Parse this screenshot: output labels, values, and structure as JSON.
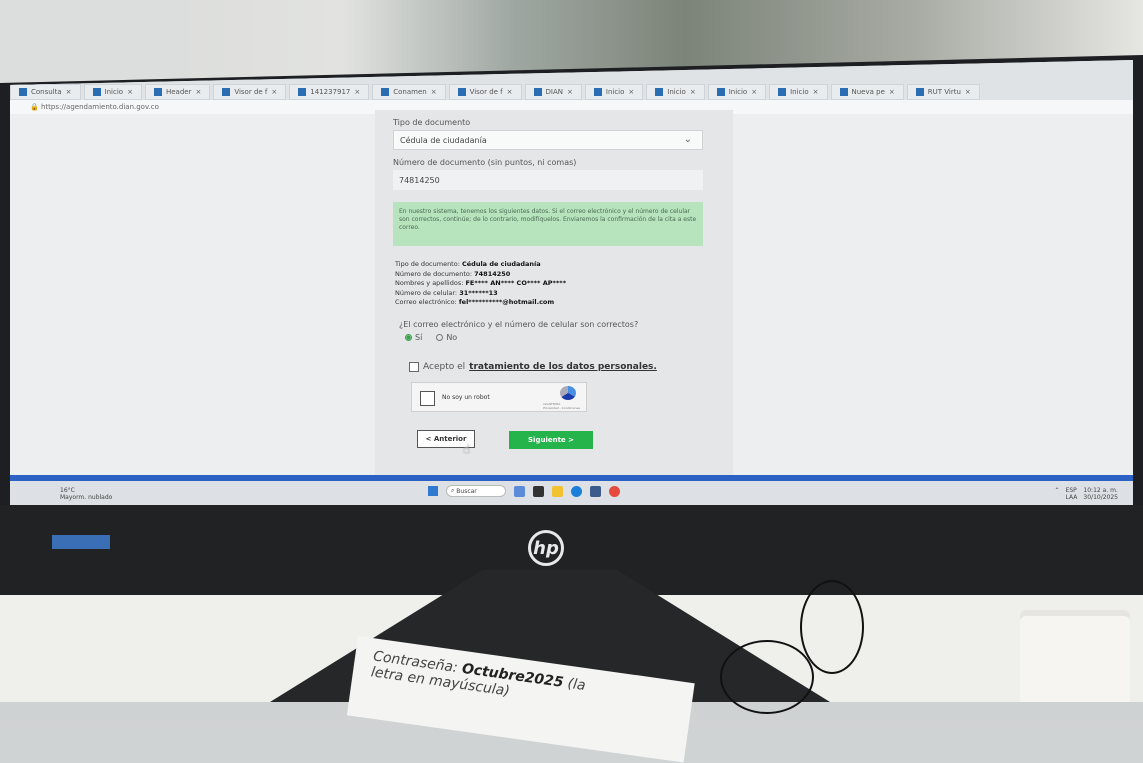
{
  "browser": {
    "tabs": [
      {
        "label": "Consulta"
      },
      {
        "label": "Inicio"
      },
      {
        "label": "Header"
      },
      {
        "label": "Visor de f"
      },
      {
        "label": "141237917"
      },
      {
        "label": "Conamen"
      },
      {
        "label": "Visor de f"
      },
      {
        "label": "DIAN"
      },
      {
        "label": "Inicio"
      },
      {
        "label": "Inicio"
      },
      {
        "label": "Inicio"
      },
      {
        "label": "Inicio"
      },
      {
        "label": "Nueva pe"
      },
      {
        "label": "RUT Virtu"
      }
    ],
    "url": "https://agendamiento.dian.gov.co"
  },
  "form": {
    "doc_type_label": "Tipo de documento",
    "doc_type_value": "Cédula de ciudadanía",
    "doc_number_label": "Número de documento (sin puntos, ni comas)",
    "doc_number_value": "74814250",
    "alert_text": "En nuestro sistema, tenemos los siguientes datos. Si el correo electrónico y el número de celular son correctos, continúe; de lo contrario, modifíquelos. Enviaremos la confirmación de la cita a este correo.",
    "info": {
      "tipo_label": "Tipo de documento:",
      "tipo_value": "Cédula de ciudadanía",
      "numero_label": "Número de documento:",
      "numero_value": "74814250",
      "nombres_label": "Nombres y apellidos:",
      "nombres_value": "FE**** AN**** CO**** AP****",
      "celular_label": "Número de celular:",
      "celular_value": "31******13",
      "correo_label": "Correo electrónico:",
      "correo_value": "fel**********@hotmail.com"
    },
    "question": "¿El correo electrónico y el número de celular son correctos?",
    "radio_yes": "Sí",
    "radio_no": "No",
    "accept_prefix": "Acepto el",
    "accept_link": "tratamiento de los datos personales.",
    "captcha_text": "No soy un robot",
    "captcha_brand": "reCAPTCHA",
    "captcha_small": "Privacidad - Condiciones",
    "prev_button": "< Anterior",
    "next_button": "Siguiente >"
  },
  "taskbar": {
    "weather": "16°C",
    "weather_sub": "Mayorm. nublado",
    "search_placeholder": "Buscar",
    "lang": "ESP",
    "lang_sub": "LAA",
    "time": "10:12 a. m.",
    "date": "30/10/2025"
  },
  "monitor_brand": "hp",
  "paper_note": {
    "line1_prefix": "Contraseña:",
    "line1_value": "Octubre2025",
    "line1_suffix": "(la",
    "line2": "letra en mayúscula)"
  }
}
